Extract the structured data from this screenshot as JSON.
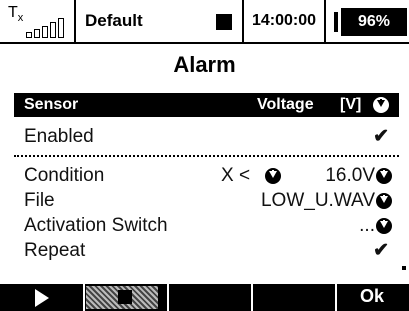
{
  "status_bar": {
    "tx_label": "T",
    "tx_sub": "x",
    "model_name": "Default",
    "timer": "14:00:00",
    "battery": "96%"
  },
  "page": {
    "title": "Alarm"
  },
  "header": {
    "sensor": "Sensor",
    "measure": "Voltage",
    "unit": "[V]"
  },
  "rows": {
    "enabled": {
      "label": "Enabled",
      "checked": true
    },
    "condition": {
      "label": "Condition",
      "operator": "X <",
      "value": "16.0V"
    },
    "file": {
      "label": "File",
      "value": "LOW_U.WAV"
    },
    "activation_switch": {
      "label": "Activation Switch",
      "value": "..."
    },
    "repeat": {
      "label": "Repeat",
      "checked": true
    }
  },
  "function_keys": {
    "f5_label": "Ok"
  },
  "icons": {
    "check": "✔",
    "dropdown": "arrow-down-circle-icon"
  }
}
